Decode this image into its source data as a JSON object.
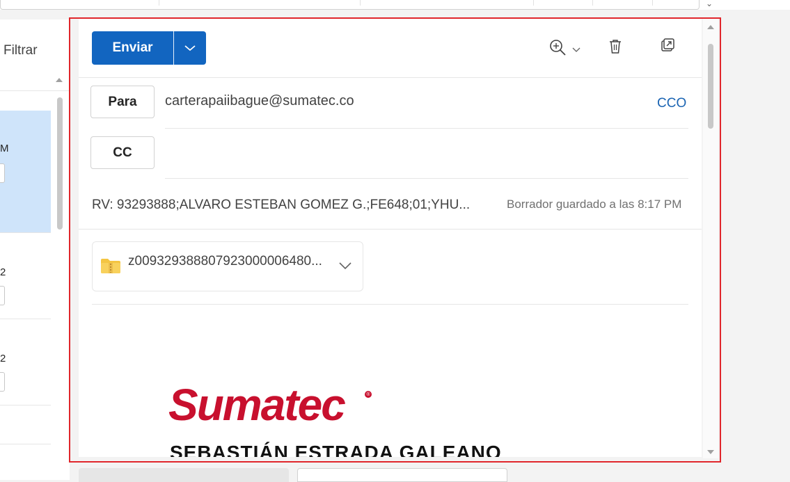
{
  "list": {
    "filter_label": "Filtrar",
    "items": [
      {
        "fragment": "M"
      },
      {
        "fragment": "2"
      },
      {
        "fragment": "2"
      }
    ]
  },
  "compose": {
    "send_label": "Enviar",
    "to_label": "Para",
    "cc_label": "CC",
    "bcc_label": "CCO",
    "to_value": "carterapaiibague@sumatec.co",
    "subject": "RV: 93293888;ALVARO ESTEBAN GOMEZ G.;FE648;01;YHU...",
    "draft_status": "Borrador guardado a las 8:17 PM",
    "attachment": {
      "name": "z009329388807923000006480...",
      "icon": "zip-folder-icon"
    },
    "signature": {
      "logo": "Sumatec",
      "name": "SEBASTIÁN ESTRADA GALEANO"
    },
    "toolbar_icons": [
      "zoom-in-icon",
      "trash-icon",
      "pop-out-icon"
    ]
  },
  "colors": {
    "accent": "#1265c0",
    "link": "#1a64b3",
    "selected": "#cfe4fa",
    "logo": "#c8102e",
    "highlight": "#e0262b"
  }
}
